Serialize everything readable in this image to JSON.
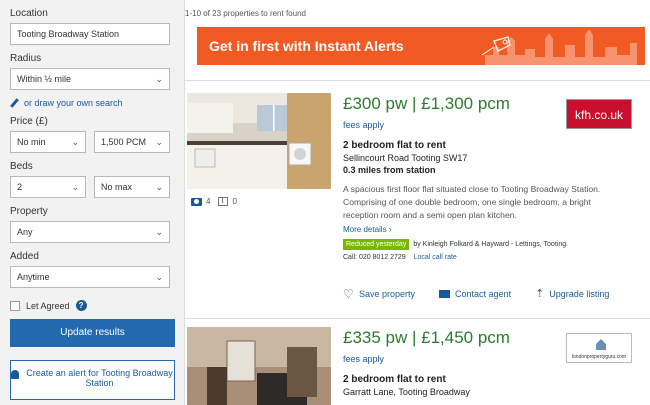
{
  "sidebar": {
    "location_label": "Location",
    "location_value": "Tooting Broadway Station",
    "radius_label": "Radius",
    "radius_value": "Within ½ mile",
    "draw_link": "or draw your own search",
    "price_label": "Price (£)",
    "price_min": "No min",
    "price_max": "1,500 PCM",
    "beds_label": "Beds",
    "beds_min": "2",
    "beds_max": "No max",
    "property_label": "Property",
    "property_value": "Any",
    "added_label": "Added",
    "added_value": "Anytime",
    "let_agreed_label": "Let Agreed",
    "let_agreed_checked": false,
    "update_button": "Update results",
    "alert_button": "Create an alert for Tooting Broadway Station"
  },
  "results": {
    "count_text": "1-10 of 23 properties to rent found",
    "banner_text": "Get in first with Instant Alerts",
    "banner_color": "#f15a22"
  },
  "listings": [
    {
      "price": "£300 pw | £1,300 pcm",
      "fees": "fees apply",
      "title": "2 bedroom flat to rent",
      "address": "Sellincourt Road Tooting SW17",
      "distance": "0.3 miles from station",
      "description": "A spacious first floor flat situated close to Tooting Broadway Station. Comprising of one double bedroom, one single bedroom, a bright reception room and a semi open plan kitchen.",
      "more": "More details ›",
      "badge": "Reduced yesterday",
      "agent": "by Kinleigh Folkard & Hayward - Lettings, Tooting.",
      "call": "Call: 020 8012 2729",
      "rate": "Local call rate",
      "photos": "4",
      "floorplans": "0",
      "agent_logo": "kfh.co.uk",
      "save": "Save property",
      "contact": "Contact agent",
      "upgrade": "Upgrade listing"
    },
    {
      "price": "£335 pw | £1,450 pcm",
      "fees": "fees apply",
      "title": "2 bedroom flat to rent",
      "address": "Garratt Lane, Tooting Broadway",
      "agent_logo": "londonpropertyguru.com"
    }
  ]
}
